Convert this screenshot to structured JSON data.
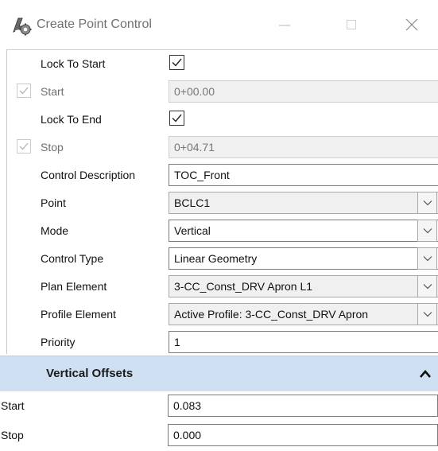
{
  "window": {
    "title": "Create Point Control"
  },
  "form": {
    "lock_to_start": {
      "label": "Lock To Start",
      "checked": true
    },
    "start": {
      "label": "Start",
      "value": "0+00.00",
      "checked": true
    },
    "lock_to_end": {
      "label": "Lock To End",
      "checked": true
    },
    "stop": {
      "label": "Stop",
      "value": "0+04.71",
      "checked": true
    },
    "control_description": {
      "label": "Control Description",
      "value": "TOC_Front"
    },
    "point": {
      "label": "Point",
      "value": "BCLC1"
    },
    "mode": {
      "label": "Mode",
      "value": "Vertical"
    },
    "control_type": {
      "label": "Control Type",
      "value": "Linear Geometry"
    },
    "plan_element": {
      "label": "Plan Element",
      "value": "3-CC_Const_DRV Apron L1"
    },
    "profile_element": {
      "label": "Profile Element",
      "value": "Active Profile: 3-CC_Const_DRV Apron"
    },
    "priority": {
      "label": "Priority",
      "value": "1"
    }
  },
  "vertical_offsets": {
    "title": "Vertical Offsets",
    "start": {
      "label": "Start",
      "value": "0.083"
    },
    "stop": {
      "label": "Stop",
      "value": "0.000"
    }
  },
  "icons": {
    "app": "create-point-control-icon",
    "minimize": "minimize-icon",
    "maximize": "maximize-icon",
    "close": "close-icon",
    "collapse": "chevron-up-icon",
    "dropdown": "chevron-down-icon",
    "check": "check-icon"
  }
}
